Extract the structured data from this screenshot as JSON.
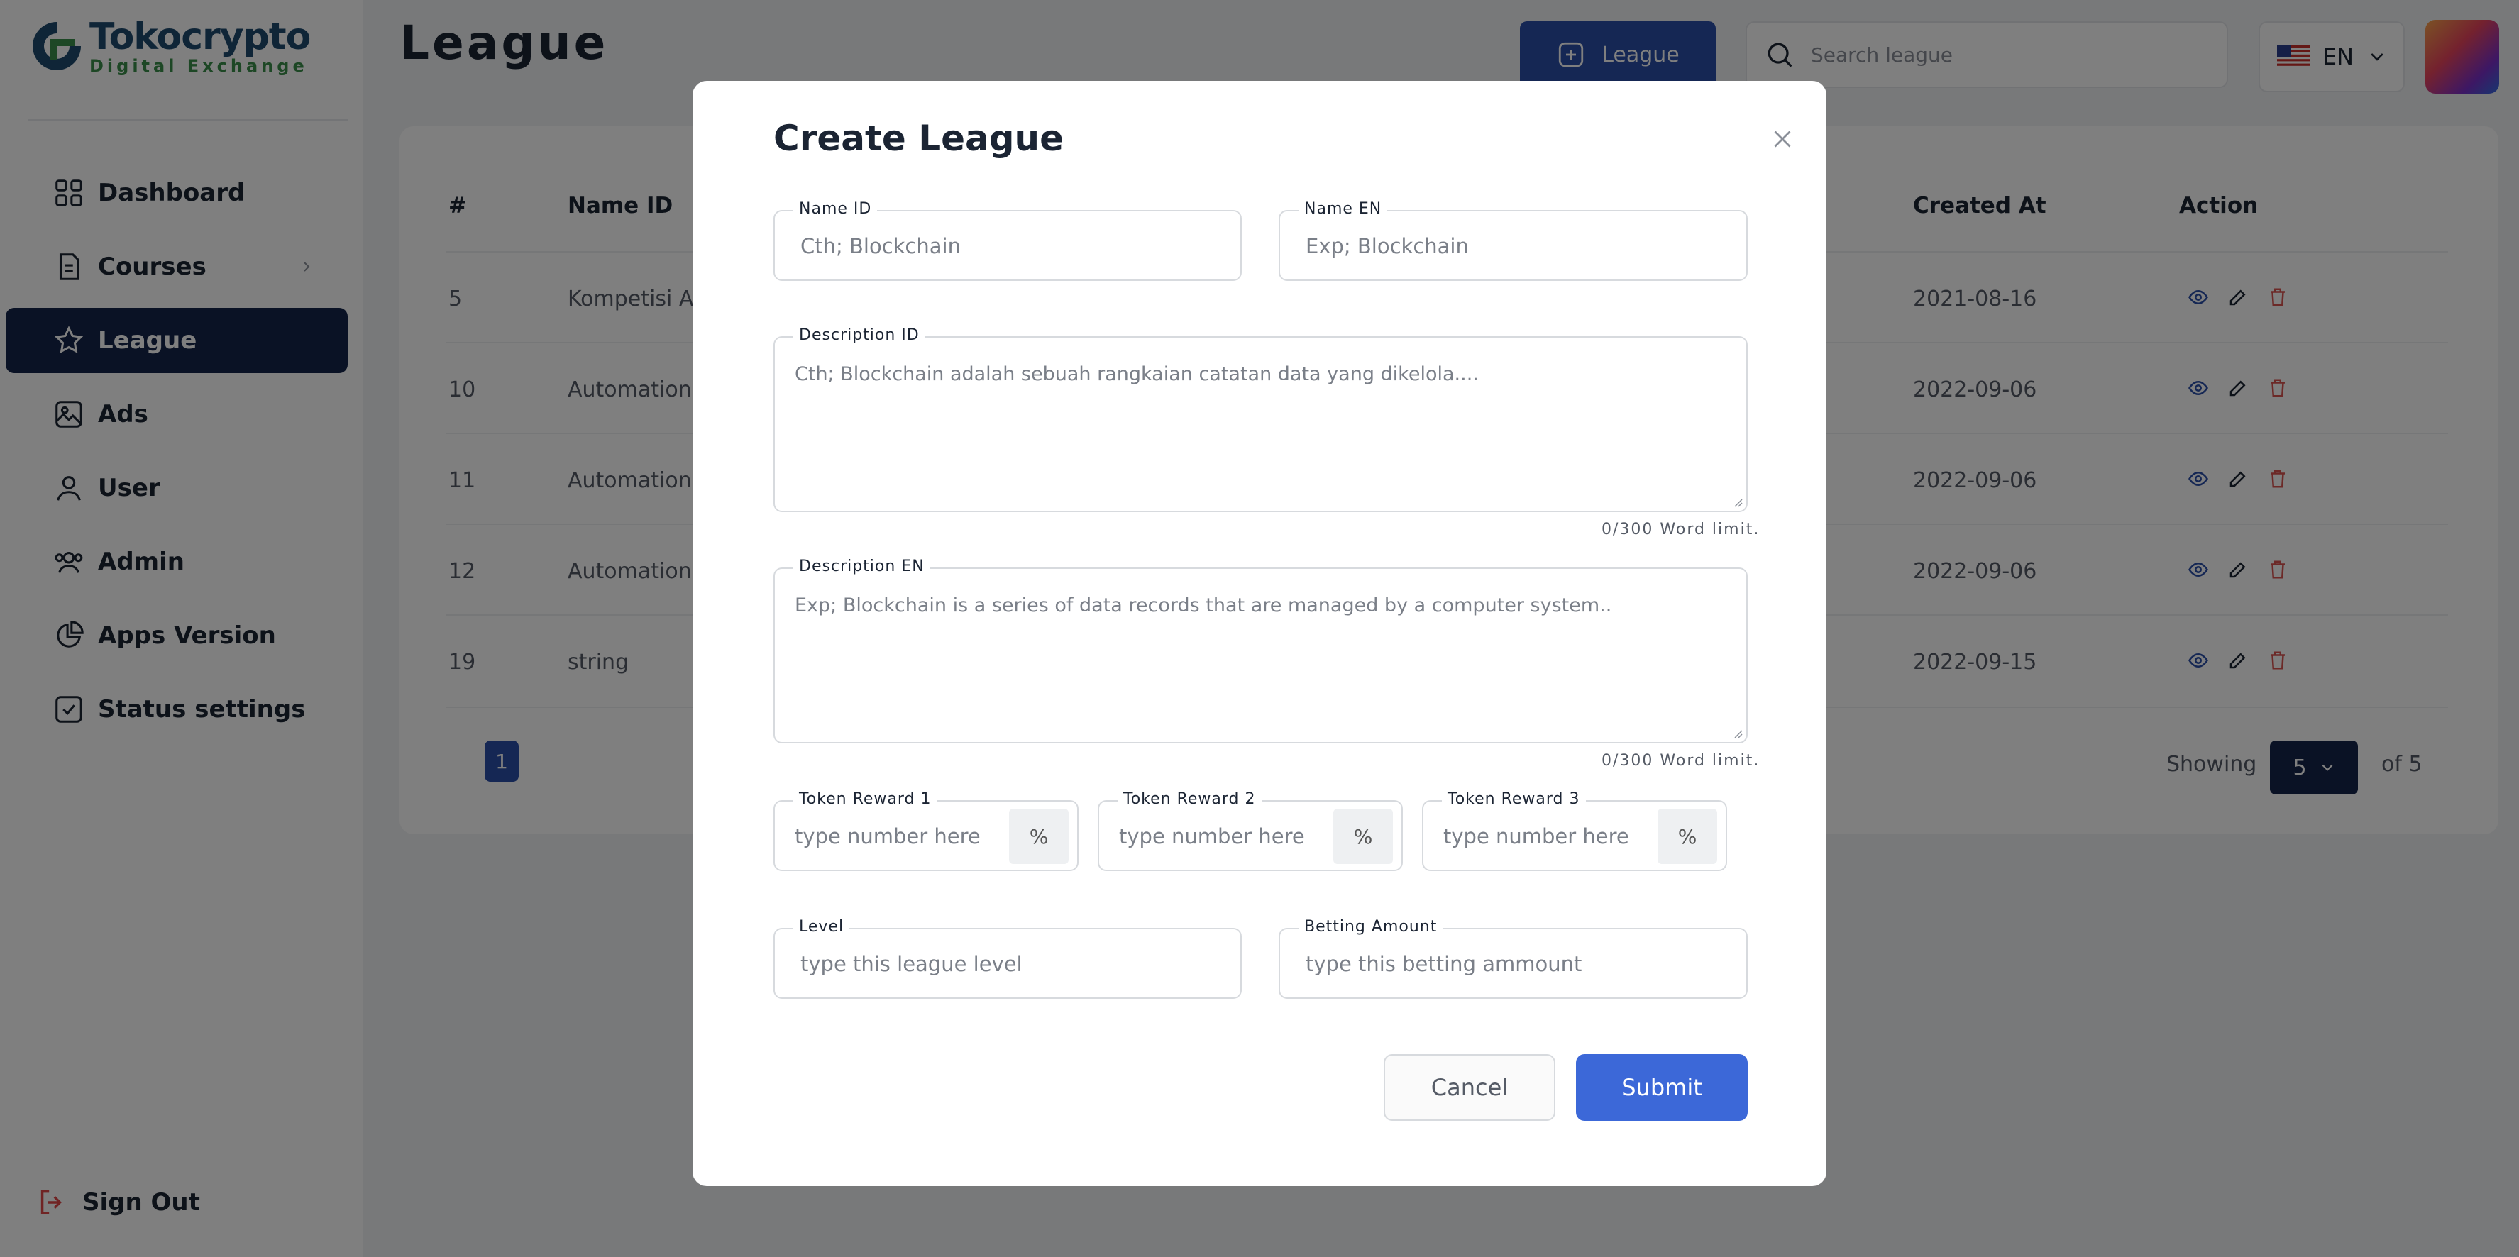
{
  "brand": {
    "name": "Tokocrypto",
    "tagline": "Digital Exchange"
  },
  "sidebar": {
    "items": [
      {
        "label": "Dashboard",
        "icon": "grid-icon",
        "active": false
      },
      {
        "label": "Courses",
        "icon": "document-icon",
        "active": false,
        "has_submenu": true
      },
      {
        "label": "League",
        "icon": "star-icon",
        "active": true
      },
      {
        "label": "Ads",
        "icon": "image-icon",
        "active": false
      },
      {
        "label": "User",
        "icon": "user-icon",
        "active": false
      },
      {
        "label": "Admin",
        "icon": "users-icon",
        "active": false
      },
      {
        "label": "Apps Version",
        "icon": "pie-chart-icon",
        "active": false
      },
      {
        "label": "Status settings",
        "icon": "checkbox-icon",
        "active": false
      }
    ],
    "sign_out": "Sign Out"
  },
  "header": {
    "title": "League",
    "add_button": "League",
    "search_placeholder": "Search league",
    "language": "EN"
  },
  "table": {
    "columns": [
      "#",
      "Name ID",
      "Created At",
      "Action"
    ],
    "rows": [
      {
        "id": "5",
        "name": "Kompetisi Ag",
        "created": "2021-08-16"
      },
      {
        "id": "10",
        "name": "Automation",
        "created": "2022-09-06"
      },
      {
        "id": "11",
        "name": "Automation",
        "created": "2022-09-06"
      },
      {
        "id": "12",
        "name": "Automation",
        "created": "2022-09-06"
      },
      {
        "id": "19",
        "name": "string",
        "created": "2022-09-15"
      }
    ],
    "pagination": {
      "current_page": "1",
      "showing_label": "Showing",
      "page_size": "5",
      "of_label": "of 5"
    }
  },
  "modal": {
    "title": "Create League",
    "name_id": {
      "label": "Name ID",
      "placeholder": "Cth; Blockchain"
    },
    "name_en": {
      "label": "Name EN",
      "placeholder": "Exp; Blockchain"
    },
    "description_id": {
      "label": "Description ID",
      "placeholder": "Cth; Blockchain adalah sebuah rangkaian catatan data yang dikelola....",
      "limit": "0/300 Word limit."
    },
    "description_en": {
      "label": "Description EN",
      "placeholder": "Exp; Blockchain is a series of data records that are managed by a computer system..",
      "limit": "0/300 Word limit."
    },
    "token_rewards": [
      {
        "label": "Token Reward 1",
        "placeholder": "type number here",
        "suffix": "%"
      },
      {
        "label": "Token Reward 2",
        "placeholder": "type number here",
        "suffix": "%"
      },
      {
        "label": "Token Reward 3",
        "placeholder": "type number here",
        "suffix": "%"
      }
    ],
    "level": {
      "label": "Level",
      "placeholder": "type this league level"
    },
    "betting_amount": {
      "label": "Betting Amount",
      "placeholder": "type this betting ammount"
    },
    "cancel": "Cancel",
    "submit": "Submit"
  },
  "colors": {
    "primary": "#2b4fa8",
    "sidebar_active": "#15254a",
    "submit": "#3c68d8",
    "brand_blue": "#1f4b6e",
    "brand_green": "#3a8f4a",
    "delete": "#d9534f"
  }
}
